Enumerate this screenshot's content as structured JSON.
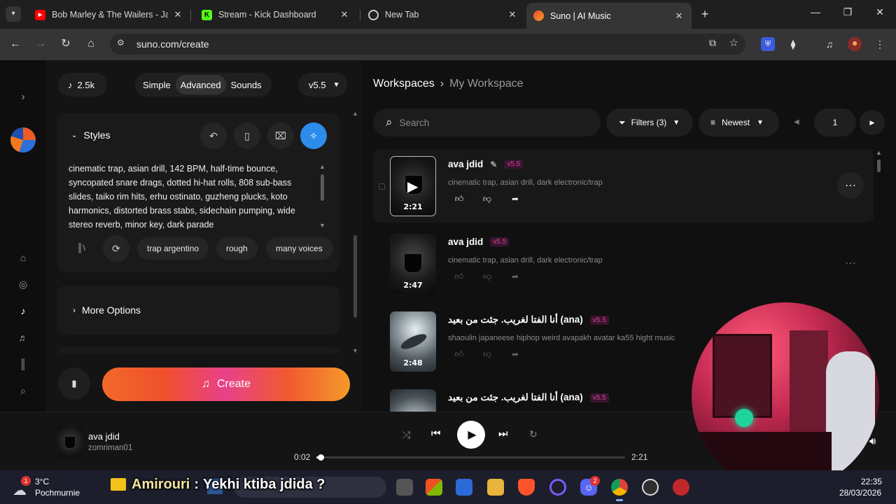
{
  "browser": {
    "tabs": [
      {
        "title": "Bob Marley & The Wailers - Jam",
        "favicon": "youtube-icon",
        "color": "#ff0000"
      },
      {
        "title": "Stream - Kick Dashboard",
        "favicon": "kick-icon",
        "color": "#53fc18"
      },
      {
        "title": "New Tab",
        "favicon": "chrome-icon",
        "color": "#cccccc"
      },
      {
        "title": "Suno | AI Music",
        "favicon": "suno-icon",
        "color": "#f04a2a"
      }
    ],
    "url": "suno.com/create"
  },
  "header": {
    "credits": "2.5k",
    "modes": [
      "Simple",
      "Advanced",
      "Sounds"
    ],
    "active_mode": "Advanced",
    "version": "v5.5"
  },
  "styles": {
    "label": "Styles",
    "prompt_lines": [
      "cinematic trap, asian drill, 142 BPM, half-time bounce,",
      "syncopated snare drags, dotted hi-hat rolls, 808 sub-bass",
      "slides, taiko rim hits, erhu ostinato, guzheng plucks, koto",
      "harmonics, distorted brass stabs, sidechain pumping, wide",
      "stereo reverb, minor key, dark parade"
    ],
    "tags": [
      "trap argentino",
      "rough",
      "many voices"
    ]
  },
  "more_options": {
    "label": "More Options"
  },
  "create": {
    "label": "Create"
  },
  "workspace": {
    "breadcrumb_root": "Workspaces",
    "breadcrumb_current": "My Workspace",
    "search_placeholder": "Search",
    "filters_label": "Filters (3)",
    "sort_label": "Newest",
    "page": "1"
  },
  "songs": [
    {
      "title": "ava jdid",
      "version": "v5.5",
      "desc": "cinematic trap, asian drill, dark electronic/trap",
      "duration": "2:21",
      "editable": true
    },
    {
      "title": "ava jdid",
      "version": "v5.5",
      "desc": "cinematic trap, asian drill, dark electronic/trap",
      "duration": "2:47",
      "editable": false
    },
    {
      "title": "أنا الفتا لغريب. جئت من بعيد (ana)",
      "version": "v5.5",
      "desc": "shaoulin japaneese hiphop weird avapakh avatar ka55 hight music",
      "duration": "2:48",
      "editable": false
    },
    {
      "title": "أنا الفتا لغريب. جئت من بعيد (ana)",
      "version": "v5.5",
      "desc": "",
      "duration": "",
      "editable": false
    }
  ],
  "player": {
    "title": "ava jdid",
    "artist": "zomriman01",
    "elapsed": "0:02",
    "total": "2:21",
    "progress": 0.014
  },
  "taskbar": {
    "weather_temp": "3°C",
    "weather_text": "Pochmurnie",
    "weather_badge": "1",
    "time": "22:35",
    "date": "28/03/2026",
    "discord_badge": "2"
  },
  "overlay": {
    "username": "Amirouri",
    "separator": ":",
    "message": "Yekhi ktiba jdida ?"
  }
}
